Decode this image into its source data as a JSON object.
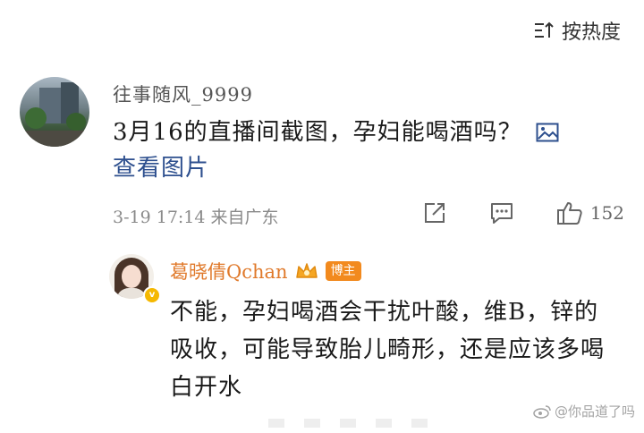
{
  "sort": {
    "label": "按热度"
  },
  "comment": {
    "username": "往事随风_9999",
    "text": "3月16的直播间截图，孕妇能喝酒吗？",
    "picture_label": "查看图片",
    "timestamp": "3-19 17:14",
    "location": "来自广东",
    "like_count": "152"
  },
  "reply": {
    "username": "葛晓倩Qchan",
    "badge": "博主",
    "verified_mark": "v",
    "text": "不能，孕妇喝酒会干扰叶酸，维B，锌的吸收，可能导致胎儿畸形，还是应该多喝白开水"
  },
  "watermark": {
    "text": "@你品道了吗"
  }
}
